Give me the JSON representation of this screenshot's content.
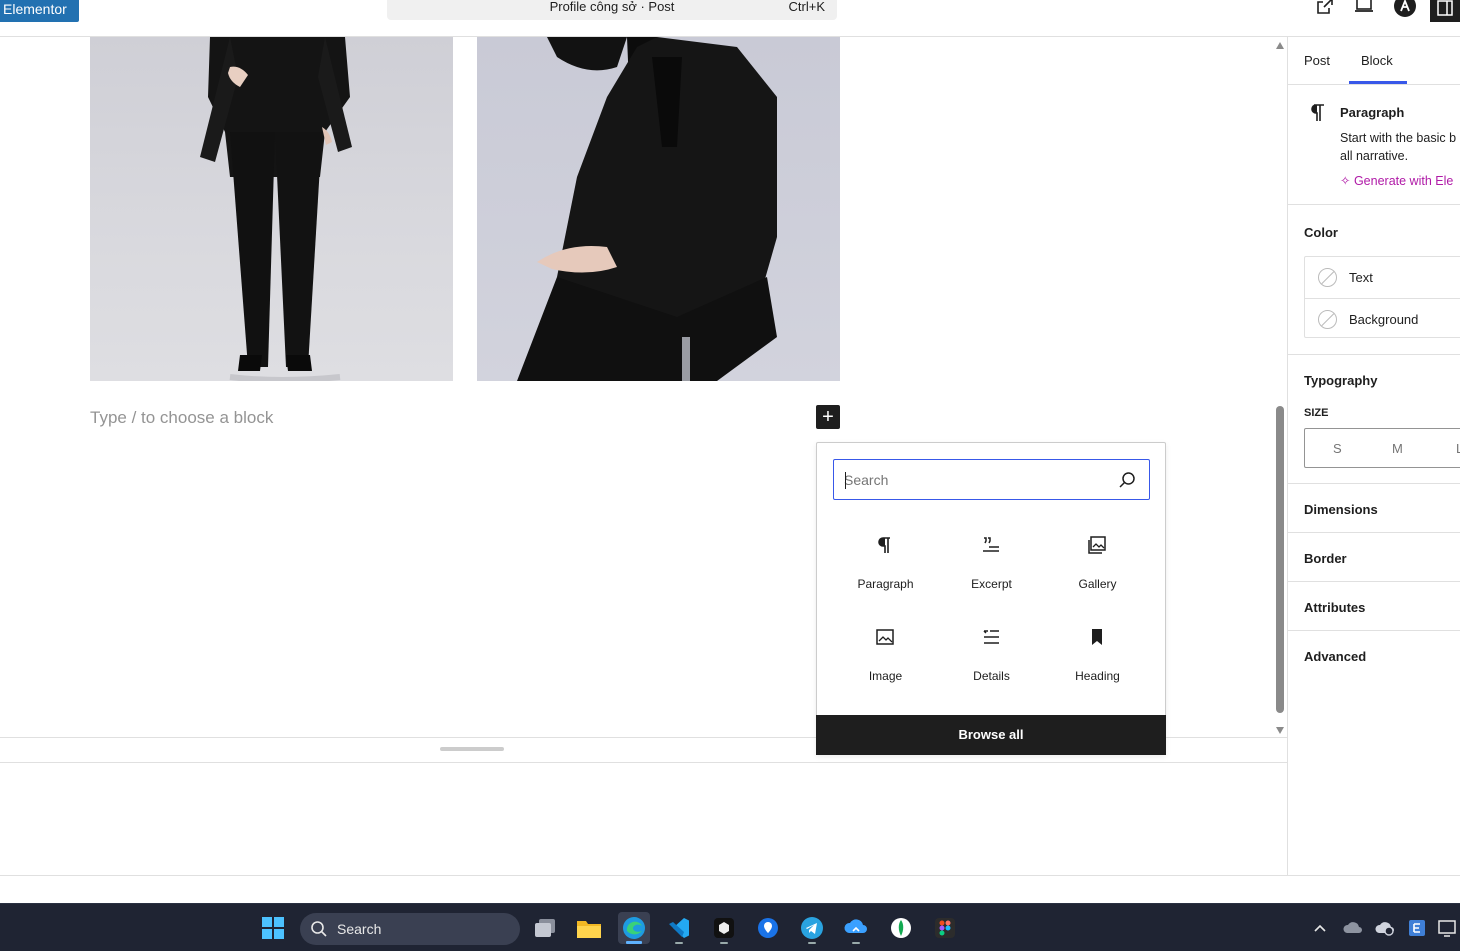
{
  "topbar": {
    "elementor_label": "Elementor",
    "command_title": "Profile công sở · Post",
    "command_shortcut": "Ctrl+K",
    "icons": [
      "external-link-icon",
      "device-preview-icon",
      "plugin-logo-icon",
      "sidebar-toggle-icon"
    ]
  },
  "canvas": {
    "placeholder": "Type / to choose a block",
    "add_block_symbol": "+"
  },
  "inserter": {
    "search_placeholder": "Search",
    "blocks": [
      {
        "label": "Paragraph",
        "icon": "paragraph-icon"
      },
      {
        "label": "Excerpt",
        "icon": "excerpt-icon"
      },
      {
        "label": "Gallery",
        "icon": "gallery-icon"
      },
      {
        "label": "Image",
        "icon": "image-icon"
      },
      {
        "label": "Details",
        "icon": "details-icon"
      },
      {
        "label": "Heading",
        "icon": "bookmark-icon"
      }
    ],
    "browse_all": "Browse all"
  },
  "sidebar": {
    "tabs": [
      "Post",
      "Block"
    ],
    "active_tab": "Block",
    "block_card": {
      "title": "Paragraph",
      "description_line1": "Start with the basic b",
      "description_line2": "all narrative.",
      "generate": "Generate with Ele"
    },
    "color": {
      "title": "Color",
      "text": "Text",
      "background": "Background"
    },
    "typography": {
      "title": "Typography",
      "size_label": "SIZE",
      "sizes": [
        "S",
        "M",
        "L"
      ]
    },
    "panels": [
      "Dimensions",
      "Border",
      "Attributes",
      "Advanced"
    ]
  },
  "taskbar": {
    "search_label": "Search",
    "apps": [
      "windows-start-icon",
      "search-icon",
      "task-view-icon",
      "file-explorer-icon",
      "edge-icon",
      "vscode-icon",
      "app-icon",
      "maps-icon",
      "telegram-icon",
      "cloud-sync-icon",
      "mongodb-icon",
      "figma-icon"
    ]
  },
  "colors": {
    "accent": "#3858e9",
    "elementor_blue": "#2271b1",
    "generate_magenta": "#b01aa7",
    "taskbar_bg": "#1f2433"
  }
}
